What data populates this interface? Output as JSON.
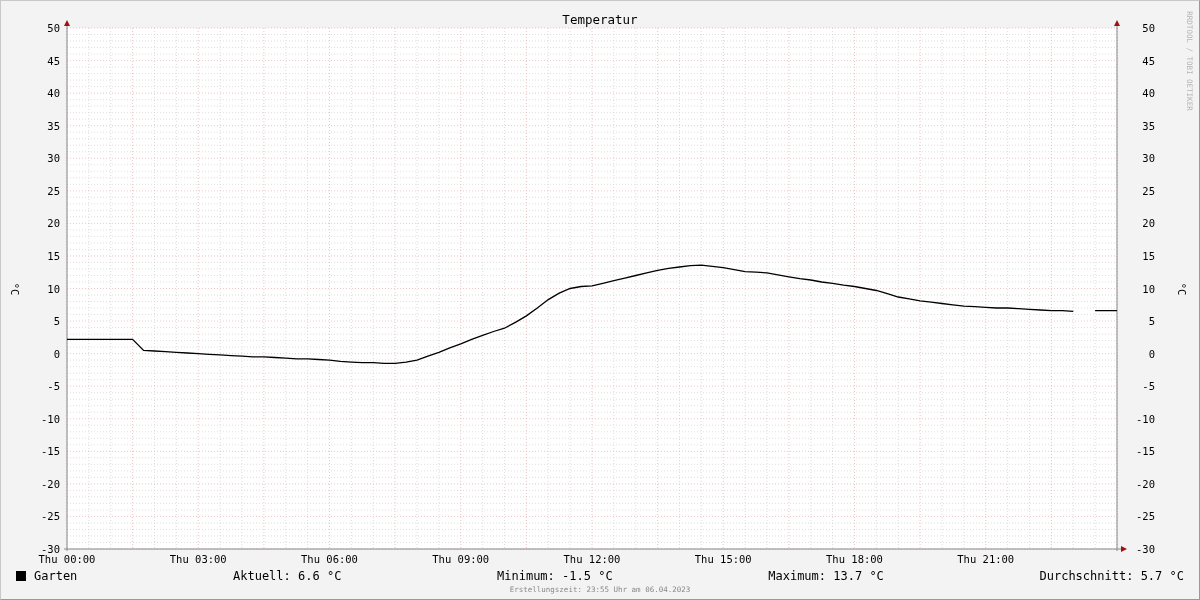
{
  "chart": {
    "watermark": "RRDTOOL / TOBI OETIKER",
    "right_ylabel": "°C",
    "right_yticks": [
      "50",
      "45",
      "40",
      "35",
      "30",
      "25",
      "20",
      "15",
      "10",
      "5",
      "0",
      "-5",
      "-10",
      "-15",
      "-20",
      "-25",
      "-30"
    ],
    "chart_data": {
      "type": "line",
      "title": "Temperatur",
      "ylabel": "°C",
      "categories": [
        "Thu 00:00",
        null,
        null,
        null,
        null,
        null,
        null,
        null,
        null,
        null,
        null,
        null,
        "Thu 03:00",
        null,
        null,
        null,
        null,
        null,
        null,
        null,
        null,
        null,
        null,
        null,
        "Thu 06:00",
        null,
        null,
        null,
        null,
        null,
        null,
        null,
        null,
        null,
        null,
        null,
        "Thu 09:00",
        null,
        null,
        null,
        null,
        null,
        null,
        null,
        null,
        null,
        null,
        null,
        "Thu 12:00",
        null,
        null,
        null,
        null,
        null,
        null,
        null,
        null,
        null,
        null,
        null,
        "Thu 15:00",
        null,
        null,
        null,
        null,
        null,
        null,
        null,
        null,
        null,
        null,
        null,
        "Thu 18:00",
        null,
        null,
        null,
        null,
        null,
        null,
        null,
        null,
        null,
        null,
        null,
        "Thu 21:00",
        null,
        null,
        null,
        null,
        null,
        null,
        null,
        null,
        null,
        null,
        null,
        null
      ],
      "series": [
        {
          "name": "Garten",
          "color": "#000000",
          "values": [
            2.2,
            2.2,
            2.2,
            2.2,
            2.2,
            2.2,
            2.2,
            0.5,
            0.4,
            0.3,
            0.2,
            0.1,
            0.0,
            -0.1,
            -0.2,
            -0.3,
            -0.4,
            -0.5,
            -0.5,
            -0.6,
            -0.7,
            -0.8,
            -0.8,
            -0.9,
            -1.0,
            -1.2,
            -1.3,
            -1.4,
            -1.4,
            -1.5,
            -1.5,
            -1.3,
            -1.0,
            -0.4,
            0.2,
            0.9,
            1.5,
            2.2,
            2.8,
            3.4,
            3.9,
            4.8,
            5.8,
            7.0,
            8.3,
            9.3,
            10.0,
            10.3,
            10.4,
            10.8,
            11.2,
            11.6,
            12.0,
            12.4,
            12.8,
            13.1,
            13.3,
            13.5,
            13.6,
            13.4,
            13.2,
            12.9,
            12.6,
            12.5,
            12.4,
            12.1,
            11.8,
            11.5,
            11.3,
            11.0,
            10.8,
            10.5,
            10.3,
            10.0,
            9.7,
            9.2,
            8.7,
            8.4,
            8.1,
            7.9,
            7.7,
            7.5,
            7.3,
            7.2,
            7.1,
            7.0,
            7.0,
            6.9,
            6.8,
            6.7,
            6.6,
            6.6,
            6.5,
            null,
            6.6,
            6.6,
            6.6
          ]
        }
      ],
      "ylim": [
        -30,
        50
      ],
      "grid": true,
      "yticks": [
        -30,
        -25,
        -20,
        -15,
        -10,
        -5,
        0,
        5,
        10,
        15,
        20,
        25,
        30,
        35,
        40,
        45,
        50
      ]
    }
  },
  "legend": {
    "stats": [
      "Aktuell: 6.6 °C",
      "Minimum: -1.5 °C",
      "Maximum: 13.7 °C",
      "Durchschnitt: 5.7 °C"
    ]
  },
  "footer": "Erstellungszeit: 23:55 Uhr am 06.04.2023"
}
